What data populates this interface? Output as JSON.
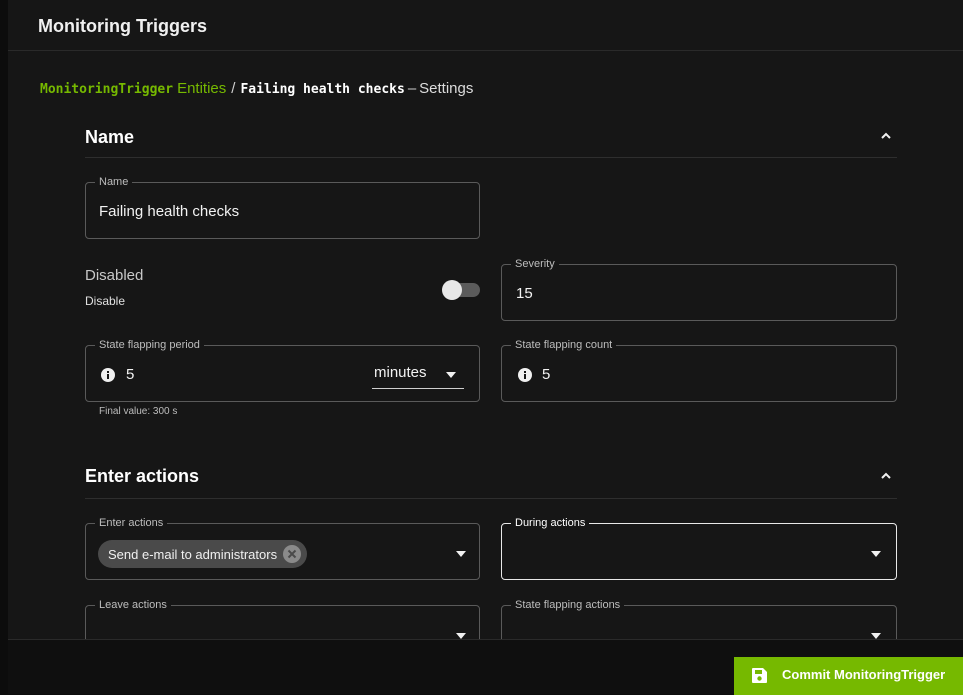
{
  "app": {
    "title": "Monitoring Triggers"
  },
  "breadcrumb": {
    "entity": "MonitoringTrigger",
    "entities_link": "Entities",
    "separator": "/",
    "item_name": "Failing health checks",
    "dash": "–",
    "page": "Settings"
  },
  "sections": {
    "name": {
      "title": "Name",
      "icon": "chevron-up-icon"
    },
    "enter_actions": {
      "title": "Enter actions",
      "icon": "chevron-up-icon"
    }
  },
  "fields": {
    "name": {
      "label": "Name",
      "value": "Failing health checks"
    },
    "disabled": {
      "label": "Disabled",
      "sublabel": "Disable",
      "on": false
    },
    "severity": {
      "label": "Severity",
      "value": "15"
    },
    "flap_period": {
      "label": "State flapping period",
      "value": "5",
      "unit": "minutes",
      "hint": "Final value: 300 s"
    },
    "flap_count": {
      "label": "State flapping count",
      "value": "5"
    },
    "enter_actions": {
      "label": "Enter actions",
      "chips": [
        "Send e-mail to administrators"
      ]
    },
    "during_actions": {
      "label": "During actions"
    },
    "leave_actions": {
      "label": "Leave actions"
    },
    "flap_actions": {
      "label": "State flapping actions"
    }
  },
  "footer": {
    "commit_label": "Commit MonitoringTrigger"
  },
  "colors": {
    "accent": "#76b900",
    "background": "#161616",
    "surface": "#0f0f0f"
  }
}
